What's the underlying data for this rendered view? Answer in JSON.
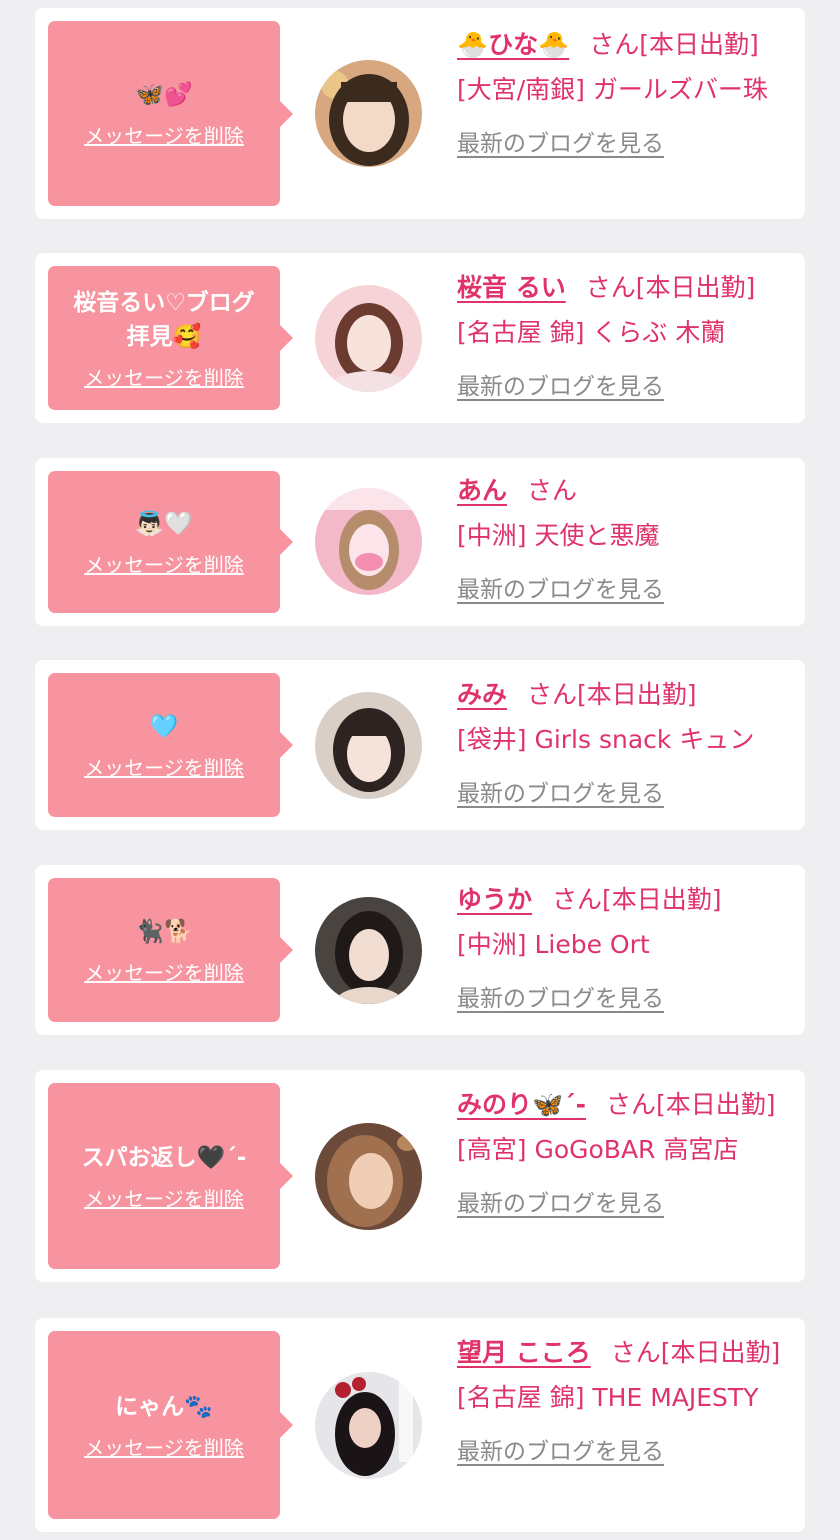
{
  "common": {
    "delete_label": "メッセージを削除",
    "blog_label": "最新のブログを見る",
    "san": "さん",
    "working": "[本日出勤]"
  },
  "colors": {
    "bubble": "#f7949f",
    "name": "#e0336a",
    "link_gray": "#8a8a8a",
    "background": "#efeff1"
  },
  "entries": [
    {
      "message": "🦋💕",
      "name": "🐣ひな🐣",
      "shop": "[大宮/南銀] ガールズバー珠",
      "working": true,
      "avatar_palette": [
        "#e8c6a3",
        "#3b2a1e",
        "#f3d9c8"
      ]
    },
    {
      "message": "桜音るい♡ブログ拝見🥰",
      "name": "桜音 るい",
      "shop": "[名古屋 錦] くらぶ 木蘭",
      "working": true,
      "avatar_palette": [
        "#f6d3d6",
        "#6a3b2e",
        "#f8e2dc"
      ]
    },
    {
      "message": "👼🏻🤍",
      "name": "あん",
      "shop": "[中洲] 天使と悪魔",
      "working": false,
      "avatar_palette": [
        "#f4b9c9",
        "#b58c6c",
        "#fbe4ea"
      ]
    },
    {
      "message": "🩵",
      "name": "みみ",
      "shop": "[袋井] Girls snack キュン",
      "working": true,
      "avatar_palette": [
        "#d9cfc6",
        "#2d2320",
        "#f5e3db"
      ]
    },
    {
      "message": "🐈‍⬛🐕",
      "name": "ゆうか",
      "shop": "[中洲] Liebe Ort",
      "working": true,
      "avatar_palette": [
        "#4a4440",
        "#1f1a18",
        "#f1ddd2"
      ]
    },
    {
      "message": "スパお返し🖤´-",
      "name": "みのり🦋´-",
      "shop": "[高宮] GoGoBAR 高宮店",
      "working": true,
      "avatar_palette": [
        "#6b4a3a",
        "#a0704f",
        "#f0cdb5"
      ]
    },
    {
      "message": "にゃん🐾",
      "name": "望月 こころ",
      "shop": "[名古屋 錦] THE MAJESTY",
      "working": true,
      "avatar_palette": [
        "#e6e6ea",
        "#1a1416",
        "#efd0c4"
      ]
    }
  ]
}
